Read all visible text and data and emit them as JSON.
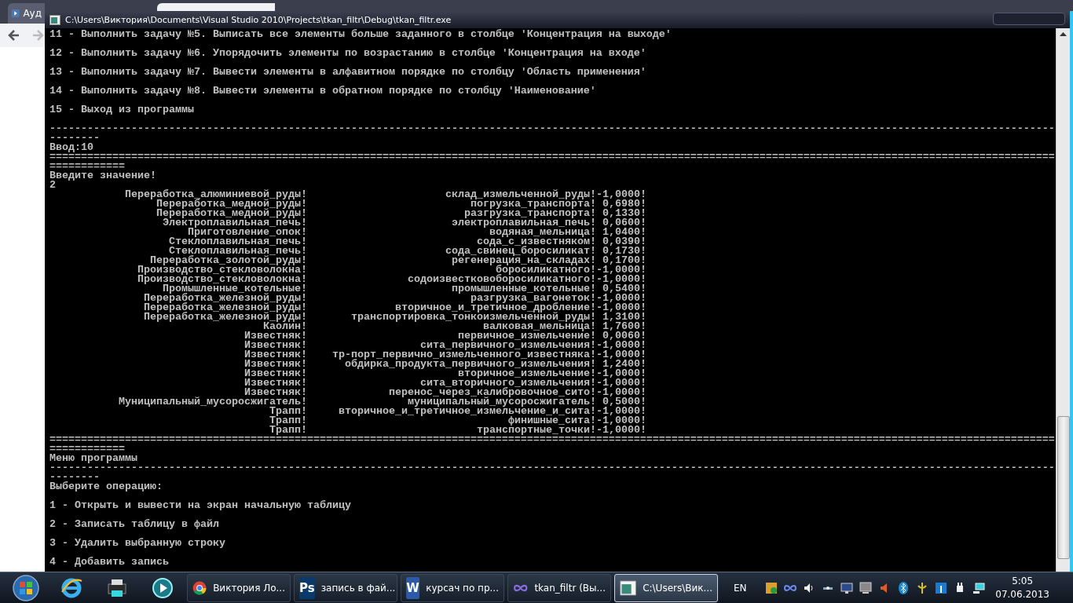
{
  "browser": {
    "tabs": [
      {
        "label": "Ауд",
        "selected": false
      },
      {
        "selected": true
      }
    ]
  },
  "console": {
    "title": "C:\\Users\\Виктория\\Documents\\Visual Studio 2010\\Projects\\tkan_filtr\\Debug\\tkan_filtr.exe",
    "lines": [
      {
        "kind": "menu",
        "text": "11 - Выполнить задачу №5. Выписать все элементы больше заданного в столбце 'Концентрация на выходе'"
      },
      {
        "kind": "menu",
        "text": "12 - Выполнить задачу №6. Упорядочить элементы по возрастанию в столбце 'Концентрация на входе'"
      },
      {
        "kind": "menu",
        "text": "13 - Выполнить задачу №7. Вывести элементы в алфавитном порядке по столбцу 'Область применения'"
      },
      {
        "kind": "menu",
        "text": "14 - Выполнить задачу №8. Вывести элементы в обратном порядке по столбцу 'Наименование'"
      },
      {
        "kind": "menu",
        "text": "15 - Выход из программы"
      },
      {
        "kind": "rule",
        "text": "----------------------------------------------------------------------------------------------------------------------------------------------------------------"
      },
      {
        "kind": "rule",
        "text": "--------"
      },
      {
        "kind": "line",
        "text": "Ввод:10"
      },
      {
        "kind": "rule",
        "text": "================================================================================================================================================================"
      },
      {
        "kind": "rule",
        "text": "============"
      },
      {
        "kind": "line",
        "text": "Введите значение!"
      },
      {
        "kind": "line",
        "text": "2"
      },
      {
        "kind": "row",
        "name": "Переработка_алюминиевой_руды!",
        "process": "склад_измельченной_руды!",
        "value": "-1,0000!"
      },
      {
        "kind": "row",
        "name": "Переработка_медной_руды!",
        "process": "погрузка_транспорта!",
        "value": "0,6980!"
      },
      {
        "kind": "row",
        "name": "Переработка_медной_руды!",
        "process": "разгрузка_транспорта!",
        "value": "0,1330!"
      },
      {
        "kind": "row",
        "name": "Электроплавильная_печь!",
        "process": "электроплавильная_печь!",
        "value": "0,0600!"
      },
      {
        "kind": "row",
        "name": "Приготовление_опок!",
        "process": "водяная_мельница!",
        "value": "1,0400!"
      },
      {
        "kind": "row",
        "name": "Стеклоплавильная_печь!",
        "process": "сода_с_известняком!",
        "value": "0,0390!"
      },
      {
        "kind": "row",
        "name": "Стеклоплавильная_печь!",
        "process": "сода_свинец_боросиликат!",
        "value": "0,1730!"
      },
      {
        "kind": "row",
        "name": "Переработка_золотой_руды!",
        "process": "регенерация_на_складах!",
        "value": "0,1700!"
      },
      {
        "kind": "row",
        "name": "Производство_стекловолокна!",
        "process": "боросиликатного!",
        "value": "-1,0000!"
      },
      {
        "kind": "row",
        "name": "Производство_стекловолокна!",
        "process": "содоизвестковоборосиликатного!",
        "value": "-1,0000!"
      },
      {
        "kind": "row",
        "name": "Промышленные_котельные!",
        "process": "промышленные_котельные!",
        "value": "0,5400!"
      },
      {
        "kind": "row",
        "name": "Переработка_железной_руды!",
        "process": "разгрузка_вагонеток!",
        "value": "-1,0000!"
      },
      {
        "kind": "row",
        "name": "Переработка_железной_руды!",
        "process": "вторичное_и_третичное_дробление!",
        "value": "-1,0000!"
      },
      {
        "kind": "row",
        "name": "Переработка_железной_руды!",
        "process": "транспортировка_тонкоизмельченной_руды!",
        "value": "1,3100!"
      },
      {
        "kind": "row",
        "name": "Каолин!",
        "process": "валковая_мельница!",
        "value": "1,7600!"
      },
      {
        "kind": "row",
        "name": "Известняк!",
        "process": "первичное_измельчение!",
        "value": "0,0060!"
      },
      {
        "kind": "row",
        "name": "Известняк!",
        "process": "сита_первичного_измельчения!",
        "value": "-1,0000!"
      },
      {
        "kind": "row",
        "name": "Известняк!",
        "process": "тр-порт_первично_измельченного_известняка!",
        "value": "-1,0000!"
      },
      {
        "kind": "row",
        "name": "Известняк!",
        "process": "обдирка_продукта_первичного_измельчения!",
        "value": "1,2400!"
      },
      {
        "kind": "row",
        "name": "Известняк!",
        "process": "вторичное_измельчение!",
        "value": "-1,0000!"
      },
      {
        "kind": "row",
        "name": "Известняк!",
        "process": "сита_вторичного_измельчения!",
        "value": "-1,0000!"
      },
      {
        "kind": "row",
        "name": "Известняк!",
        "process": "перенос_через_калибровочное_сито!",
        "value": "-1,0000!"
      },
      {
        "kind": "row",
        "name": "Муниципальный_мусоросжигатель!",
        "process": "муниципальный_мусоросжигатель!",
        "value": "0,5000!"
      },
      {
        "kind": "row",
        "name": "Трапп!",
        "process": "вторичное_и_третичное_измельчение_и_сита!",
        "value": "-1,0000!"
      },
      {
        "kind": "row",
        "name": "Трапп!",
        "process": "финишные_сита!",
        "value": "-1,0000!"
      },
      {
        "kind": "row",
        "name": "Трапп!",
        "process": "транспортные_точки!",
        "value": "-1,0000!"
      },
      {
        "kind": "rule",
        "text": "================================================================================================================================================================"
      },
      {
        "kind": "rule",
        "text": "============"
      },
      {
        "kind": "line",
        "text": "Меню программы"
      },
      {
        "kind": "rule",
        "text": "----------------------------------------------------------------------------------------------------------------------------------------------------------------"
      },
      {
        "kind": "rule",
        "text": "--------"
      },
      {
        "kind": "menu",
        "text": "Выберите операцию:"
      },
      {
        "kind": "menu",
        "text": "1 - Открыть и вывести на экран начальную таблицу"
      },
      {
        "kind": "menu",
        "text": "2 - Записать таблицу в файл"
      },
      {
        "kind": "menu",
        "text": "3 - Удалить выбранную строку"
      },
      {
        "kind": "menu",
        "text": "4 - Добавить запись"
      }
    ]
  },
  "taskbar": {
    "pinned": [
      {
        "kind": "ie"
      },
      {
        "kind": "printer"
      },
      {
        "kind": "media"
      }
    ],
    "tasks": [
      {
        "kind": "chrome",
        "label": "Виктория Ло...",
        "selected": false
      },
      {
        "kind": "ps",
        "icon_label": "Ps",
        "label": "запись в фай...",
        "selected": false
      },
      {
        "kind": "word",
        "icon_label": "W",
        "label": "курсач по пр...",
        "selected": false
      },
      {
        "kind": "vs",
        "label": "tkan_filtr (Вы...",
        "selected": false
      },
      {
        "kind": "console",
        "label": "C:\\Users\\Вик...",
        "selected": true
      }
    ],
    "language": "EN",
    "time": "5:05",
    "date": "07.06.2013"
  }
}
